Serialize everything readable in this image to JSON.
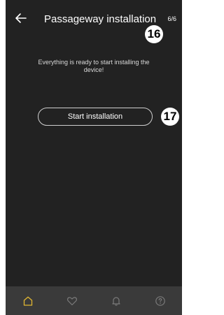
{
  "header": {
    "back_icon": "arrow-left-icon",
    "title": "Passageway installation",
    "step": "6/6"
  },
  "callouts": {
    "step_marker": "16",
    "button_marker": "17"
  },
  "content": {
    "message": "Everything is ready to start installing the device!",
    "start_button_label": "Start installation"
  },
  "bottom_nav": {
    "items": [
      {
        "icon": "home-icon",
        "active": true
      },
      {
        "icon": "heart-icon",
        "active": false
      },
      {
        "icon": "bell-icon",
        "active": false
      },
      {
        "icon": "help-icon",
        "active": false
      }
    ]
  },
  "colors": {
    "background": "#222222",
    "nav_background": "#3a3a3a",
    "accent": "#e0b632",
    "inactive_icon": "#7a7a7a"
  }
}
